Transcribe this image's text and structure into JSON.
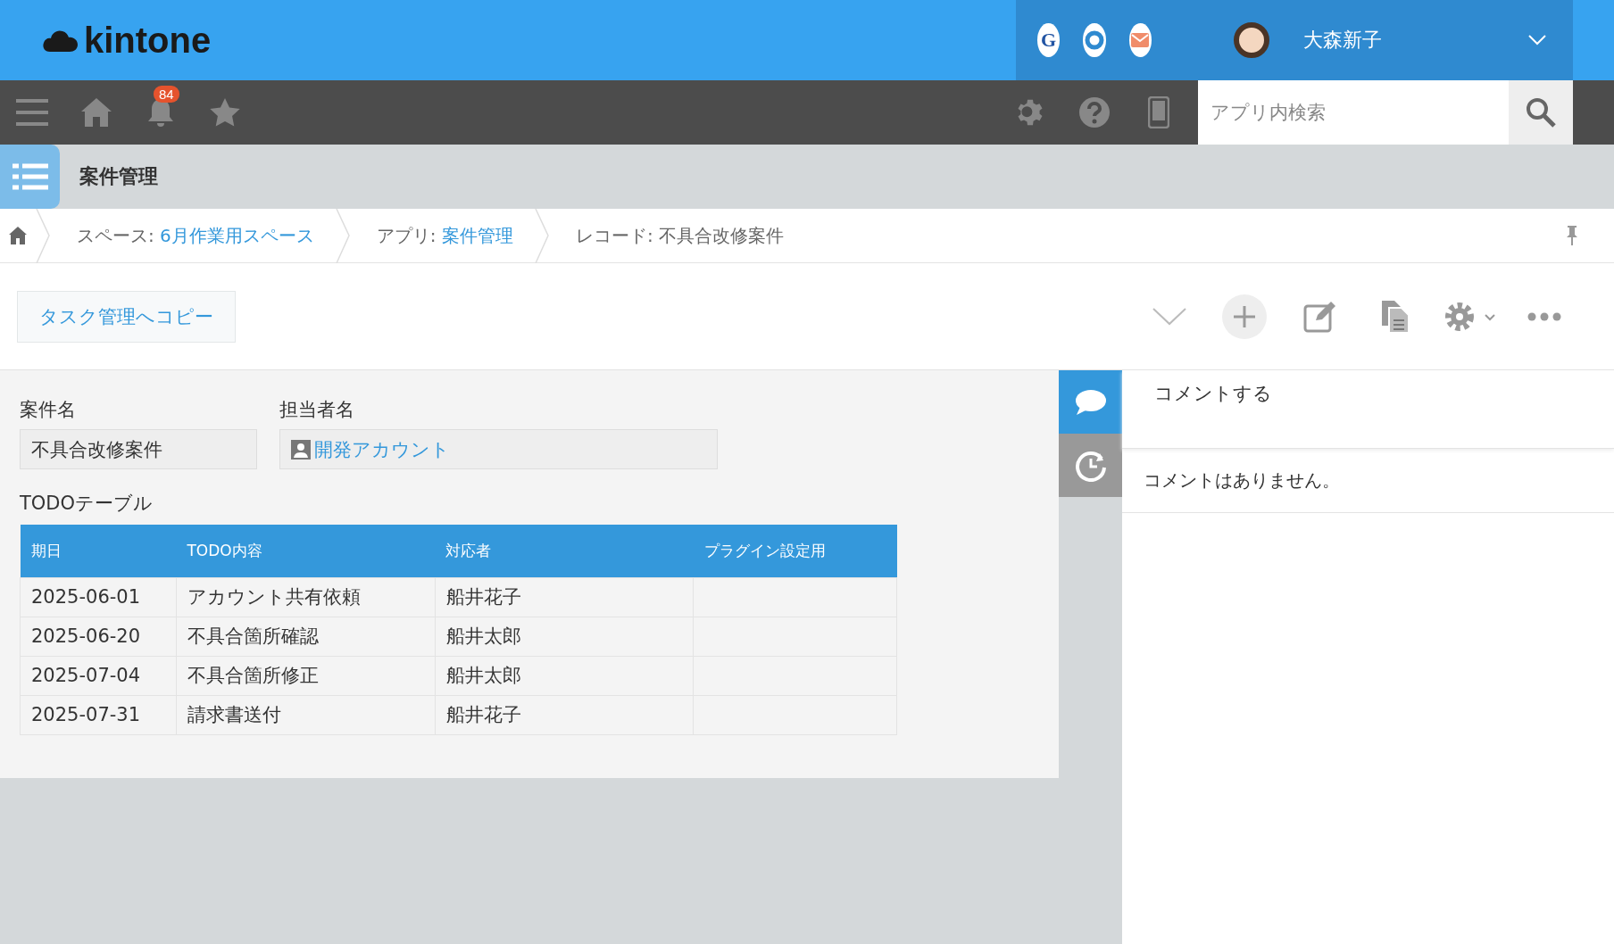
{
  "header": {
    "logo": "kintone",
    "services": [
      {
        "kind": "letter",
        "label": "G"
      },
      {
        "kind": "ring"
      },
      {
        "kind": "mail"
      }
    ],
    "user": {
      "name": "大森新子"
    }
  },
  "nav": {
    "notification_count": "84",
    "search": {
      "placeholder": "アプリ内検索"
    }
  },
  "app": {
    "title": "案件管理"
  },
  "breadcrumb": [
    {
      "label": "スペース: ",
      "link": "6月作業用スペース"
    },
    {
      "label": "アプリ: ",
      "link": "案件管理"
    },
    {
      "label": "レコード: 不具合改修案件"
    }
  ],
  "toolbar": {
    "action_button": "タスク管理へコピー"
  },
  "fields": [
    {
      "kind": "text",
      "label": "案件名",
      "value": "不具合改修案件"
    },
    {
      "kind": "user",
      "label": "担当者名",
      "value": "開発アカウント"
    }
  ],
  "table": {
    "title": "TODOテーブル",
    "columns": [
      "期日",
      "TODO内容",
      "対応者",
      "プラグイン設定用"
    ],
    "rows": [
      [
        "2025-06-01",
        "アカウント共有依頼",
        "船井花子",
        ""
      ],
      [
        "2025-06-20",
        "不具合箇所確認",
        "船井太郎",
        ""
      ],
      [
        "2025-07-04",
        "不具合箇所修正",
        "船井太郎",
        ""
      ],
      [
        "2025-07-31",
        "請求書送付",
        "船井花子",
        ""
      ]
    ]
  },
  "side_tabs": [
    {
      "kind": "comments",
      "selected": true
    },
    {
      "kind": "history",
      "selected": false
    }
  ],
  "comments": {
    "placeholder": "コメントする",
    "empty_message": "コメントはありません。"
  }
}
